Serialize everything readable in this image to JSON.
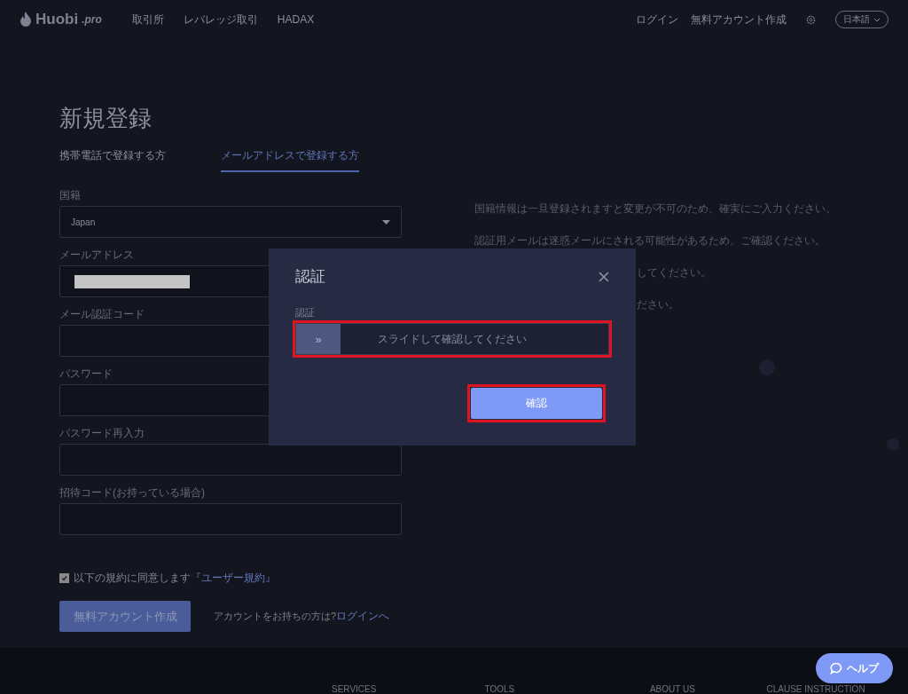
{
  "header": {
    "logo": {
      "name": "Huobi",
      "suffix": ".pro"
    },
    "nav": [
      {
        "label": "取引所"
      },
      {
        "label": "レバレッジ取引"
      },
      {
        "label": "HADAX"
      }
    ],
    "right": [
      {
        "label": "ログイン"
      },
      {
        "label": "無料アカウント作成"
      }
    ],
    "language": "日本語"
  },
  "title": "新規登録",
  "tabs": [
    {
      "label": "携帯電話で登録する方",
      "selected": false
    },
    {
      "label": "メールアドレスで登録する方",
      "selected": true
    }
  ],
  "fields": [
    {
      "kind": "select",
      "label": "国籍",
      "value": "Japan"
    },
    {
      "kind": "redacted",
      "label": "メールアドレス"
    },
    {
      "kind": "input",
      "label": "メール認証コード"
    },
    {
      "kind": "input",
      "label": "パスワード"
    },
    {
      "kind": "input",
      "label": "パスワード再入力"
    },
    {
      "kind": "input",
      "label": "招待コード(お持っている場合)"
    }
  ],
  "agreement": {
    "checked": true,
    "text": "以下の規約に同意します",
    "link": "『ユーザー規約』"
  },
  "submit": "無料アカウント作成",
  "login_prompt": {
    "text": "アカウントをお持ちの方は?",
    "link": "ログインへ"
  },
  "notes": [
    {
      "kind": "full",
      "text": "国籍情報は一旦登録されますと変更が不可のため、確実にご入力ください。"
    },
    {
      "kind": "full",
      "text": "認証用メールは迷惑メールにされる可能性があるため、ご確認ください。"
    },
    {
      "kind": "covered",
      "text": "してください。"
    },
    {
      "kind": "covered",
      "text": "ださい。"
    }
  ],
  "dialog": {
    "title": "認証",
    "slider_label": "認証",
    "slider": {
      "handle": "»",
      "text": "スライドして確認してください",
      "highlighted": true
    },
    "confirm": {
      "label": "確認",
      "highlighted": true
    }
  },
  "footer": {
    "headings": [
      "SERVICES",
      "TOOLS",
      "ABOUT US",
      "CLAUSE INSTRUCTION"
    ]
  },
  "help": "ヘルプ"
}
